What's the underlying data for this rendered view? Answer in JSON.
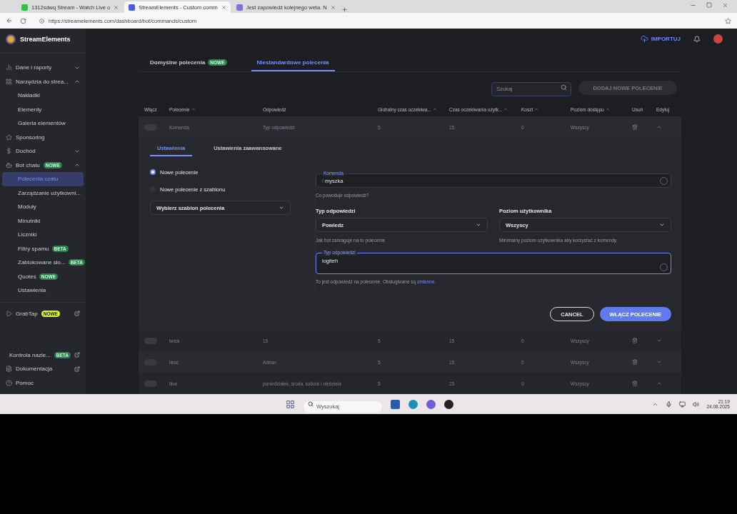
{
  "browser": {
    "tabs": [
      {
        "title": "1312sdwq Stream - Watch Live o",
        "selected": false
      },
      {
        "title": "StreamElements - Custom comm",
        "selected": true
      },
      {
        "title": "Jest zapowiedź kolejnego weta. N",
        "selected": false
      }
    ],
    "url": "https://streamelements.com/dashboard/bot/commands/custom"
  },
  "sidebar": {
    "brand": "StreamElements",
    "items": [
      {
        "label": "Dane i raporty",
        "expanded": false
      },
      {
        "label": "Narzędzia do strea...",
        "expanded": true,
        "children": [
          {
            "label": "Nakładki",
            "selected": false
          },
          {
            "label": "Elementy",
            "selected": false
          },
          {
            "label": "Galeria elementów",
            "selected": false
          }
        ]
      },
      {
        "label": "Sponsoring"
      },
      {
        "label": "Dochód",
        "expanded": false
      },
      {
        "label": "Bot chatu",
        "badge": {
          "text": "NOWE",
          "color": "#2e7d4f"
        },
        "expanded": true,
        "children": [
          {
            "label": "Polecenia czatu",
            "selected": true
          },
          {
            "label": "Zarządzanie użytkowni...",
            "selected": false
          },
          {
            "label": "Moduły",
            "selected": false
          },
          {
            "label": "Minutniki",
            "selected": false
          },
          {
            "label": "Liczniki",
            "selected": false
          },
          {
            "label": "Filtry spamu",
            "selected": false,
            "badge": {
              "text": "BETA",
              "color": "#2e7d4f"
            }
          },
          {
            "label": "Zablokowane sło...",
            "selected": false,
            "badge": {
              "text": "BETA",
              "color": "#2e7d4f"
            }
          },
          {
            "label": "Quotes",
            "selected": false,
            "badge": {
              "text": "NOWE",
              "color": "#2e7d4f"
            }
          },
          {
            "label": "Ustawienia",
            "selected": false
          }
        ]
      }
    ],
    "extra": [
      {
        "label": "GrabTap",
        "badge": {
          "text": "NOWE",
          "color": "#d9f23a"
        },
        "external": true
      }
    ],
    "footer": [
      {
        "label": "Kontrola nazie...",
        "badge": {
          "text": "BETA",
          "color": "#2e7d4f"
        },
        "external": true
      },
      {
        "label": "Dokumentacja",
        "external": true
      },
      {
        "label": "Pomoc",
        "external": false
      }
    ]
  },
  "header": {
    "import_label": "IMPORTUJ"
  },
  "tabs": [
    {
      "label": "Domyślne polecenia",
      "badge": "NOWE",
      "selected": false
    },
    {
      "label": "Niestandardowe polecenia",
      "selected": true
    }
  ],
  "search": {
    "placeholder": "Szukaj"
  },
  "add_button": {
    "label": "DODAJ NOWE POLECENIE",
    "disabled": true
  },
  "table": {
    "columns": [
      {
        "label": "Włącz",
        "sortable": false
      },
      {
        "label": "Polecenie",
        "sortable": true
      },
      {
        "label": "Odpowiedź",
        "sortable": false
      },
      {
        "label": "Globalny czas oczekiwa...",
        "sortable": true
      },
      {
        "label": "Czas oczekiwania użytk...",
        "sortable": true
      },
      {
        "label": "Koszt",
        "sortable": true
      },
      {
        "label": "Poziom dostępu",
        "sortable": true
      },
      {
        "label": "Usuń",
        "sortable": false
      },
      {
        "label": "Edytuj",
        "sortable": false
      }
    ],
    "rows": [
      {
        "enabled": false,
        "expanded": true,
        "cells": [
          "",
          "Komenda",
          "Typ odpowiedzi",
          "5",
          "15",
          "0",
          "Wszyscy"
        ]
      },
      {
        "enabled": false,
        "expanded": false,
        "cells": [
          "",
          "twick",
          "15",
          "5",
          "15",
          "0",
          "Wszyscy"
        ]
      },
      {
        "enabled": false,
        "expanded": false,
        "cells": [
          "",
          "ilesc",
          "Adrian",
          "5",
          "15",
          "0",
          "Wszyscy"
        ]
      },
      {
        "enabled": false,
        "expanded": true,
        "cells": [
          "",
          "llive",
          "poniedziałek, środa, sobota i niedziela",
          "5",
          "15",
          "0",
          "Wszyscy"
        ]
      }
    ]
  },
  "form": {
    "tabs": [
      {
        "label": "Ustawienia",
        "selected": true
      },
      {
        "label": "Ustawienia zaawansowane",
        "selected": false
      }
    ],
    "options": [
      {
        "label": "Nowe polecenie",
        "selected": true
      },
      {
        "label": "Nowe polecenie z szablonu",
        "selected": false
      }
    ],
    "template_select": "Wybierz szablon polecenia",
    "command_field": {
      "label": "Komenda",
      "prefix": "!",
      "value": "myszka",
      "hint": "Co powoduje odpowiedź?"
    },
    "response_type": {
      "label": "Typ odpowiedzi",
      "value": "Powiedz",
      "hint": "Jak bot zareaguje na to polecenie"
    },
    "user_level": {
      "label": "Poziom użytkownika",
      "value": "Wszyscy",
      "hint": "Minimalny poziom użytkownika aby korzystać z komendy."
    },
    "response_field": {
      "label": "Typ odpowiedzi",
      "value": "logiteh",
      "hint": "To jest odpowiedź na polecenie. Obsługiwane są",
      "hint_link": "zmienne",
      "hint_end": "."
    },
    "cancel": "CANCEL",
    "submit": "WŁĄCZ POLECENIE"
  },
  "taskbar": {
    "search_placeholder": "Wyszukaj",
    "time": "21:19",
    "date": "24.08.2025"
  }
}
